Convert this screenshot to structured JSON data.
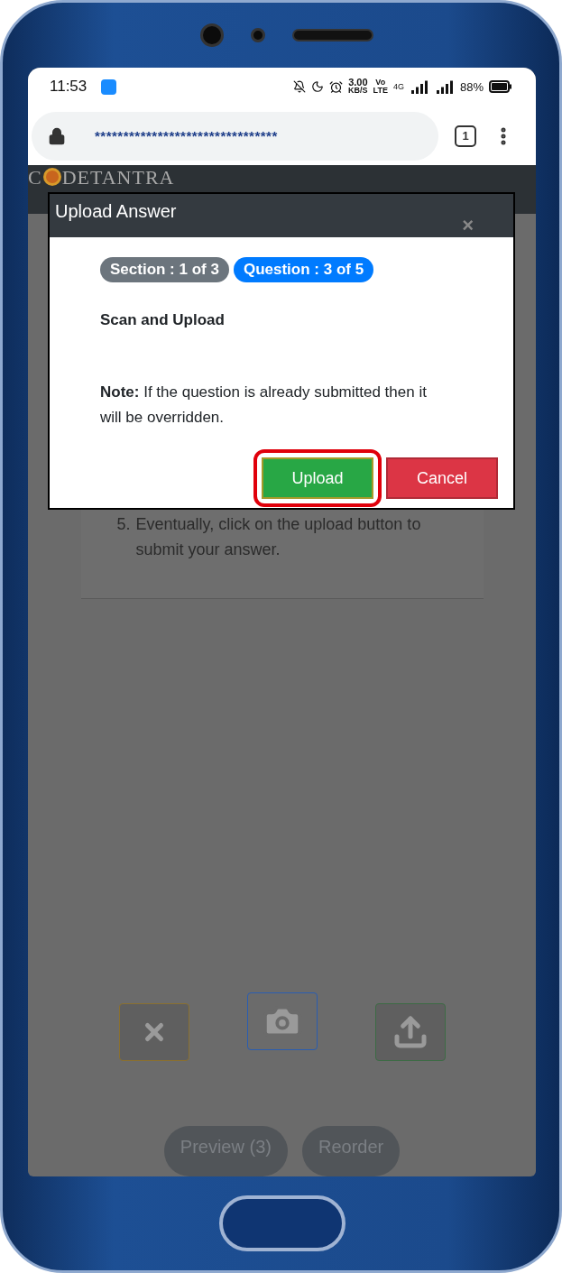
{
  "status_bar": {
    "time": "11:53",
    "speed": "3.00",
    "speed_unit": "KB/S",
    "volte_top": "Vo",
    "volte_bottom": "LTE",
    "network": "4G",
    "battery": "88%"
  },
  "browser": {
    "url": "********************************",
    "tab_count": "1"
  },
  "app_header": {
    "logo_start": "C",
    "logo_end": "DETANTRA"
  },
  "instructions": [
    {
      "number": "5.",
      "text": "Eventually, click on the upload button to submit your answer."
    }
  ],
  "tool_buttons": [
    {
      "kind": "discard"
    },
    {
      "kind": "camera"
    },
    {
      "kind": "upload"
    }
  ],
  "bottom_buttons": [
    "Preview (3)",
    "Reorder"
  ],
  "modal": {
    "title": "Upload Answer",
    "close": "×",
    "badges": [
      {
        "label": "Section : 1 of 3",
        "color": "#6c757d"
      },
      {
        "label": "Question : 3 of 5",
        "color": "#007bff"
      }
    ],
    "heading": "Scan and Upload",
    "note": "**Note:** If the question is already submitted then it will be overridden.",
    "buttons": [
      {
        "label": "Upload",
        "kind": "success",
        "highlighted": true
      },
      {
        "label": "Cancel",
        "kind": "danger",
        "highlighted": false
      }
    ]
  }
}
